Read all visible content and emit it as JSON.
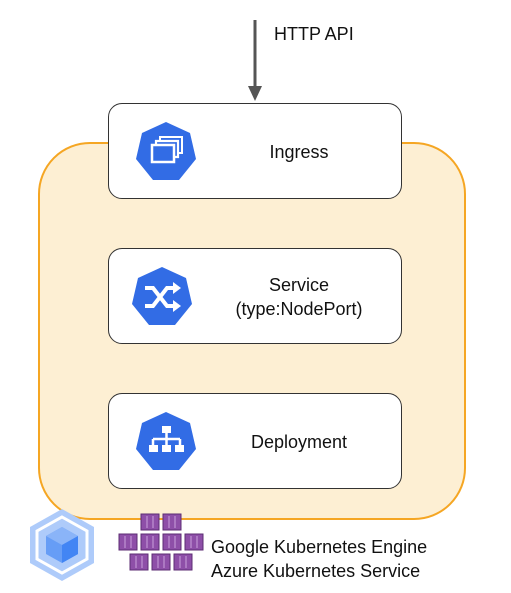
{
  "api": {
    "label": "HTTP API"
  },
  "nodes": {
    "ingress": {
      "label": "Ingress",
      "icon": "ingress-icon"
    },
    "service": {
      "label_line1": "Service",
      "label_line2": "(type:NodePort)",
      "icon": "service-shuffle-icon"
    },
    "deployment": {
      "label": "Deployment",
      "icon": "deployment-hierarchy-icon"
    }
  },
  "footer": {
    "line1": "Google Kubernetes Engine",
    "line2": "Azure Kubernetes Service"
  },
  "colors": {
    "cluster_border": "#f5a623",
    "cluster_fill": "#fdefd3",
    "k8s_blue": "#326ce5",
    "gke_blue": "#8ab4f8",
    "aks_purple": "#8e4fa8"
  }
}
